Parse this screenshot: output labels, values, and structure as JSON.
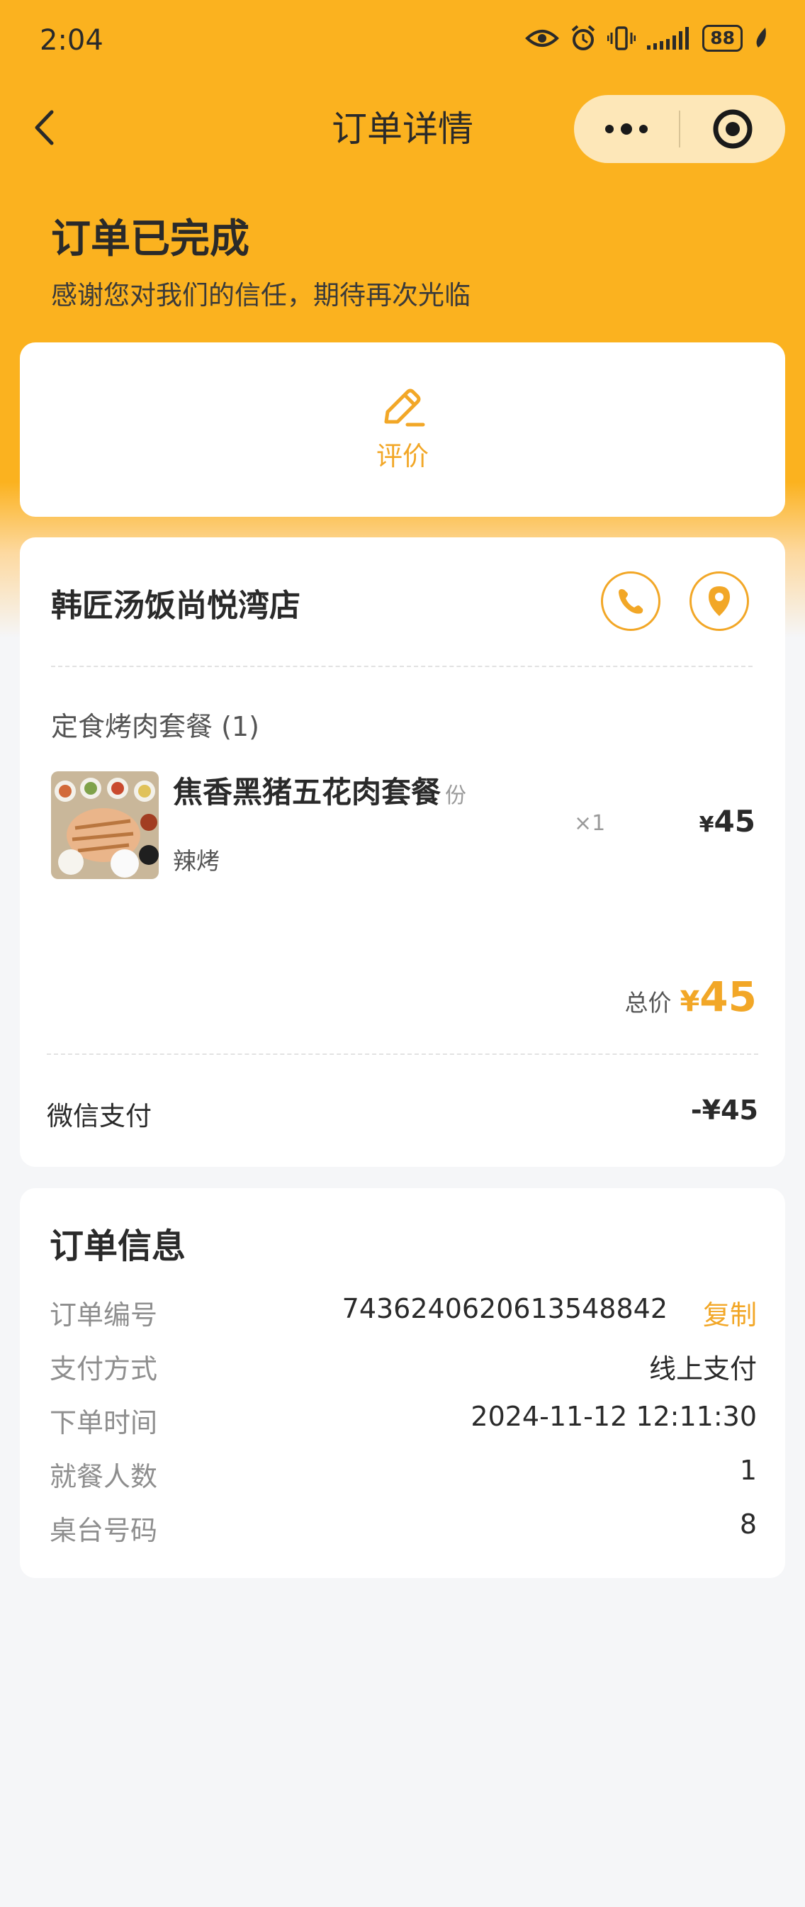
{
  "status_bar": {
    "time": "2:04",
    "battery": "88"
  },
  "nav": {
    "title": "订单详情"
  },
  "order_status": {
    "title": "订单已完成",
    "subtitle": "感谢您对我们的信任，期待再次光临"
  },
  "review": {
    "label": "评价"
  },
  "shop": {
    "name": "韩匠汤饭尚悦湾店",
    "category": "定食烤肉套餐 (1)",
    "item": {
      "name": "焦香黑猪五花肉套餐",
      "unit": "份",
      "spec": "辣烤",
      "quantity": "×1",
      "currency": "¥",
      "price": "45"
    },
    "total_label": "总价",
    "total_currency": "¥",
    "total_value": "45",
    "payment_method": "微信支付",
    "payment_amount": "-¥45"
  },
  "order_info": {
    "title": "订单信息",
    "rows": [
      {
        "label": "订单编号",
        "value": "7436240620613548842"
      },
      {
        "label": "支付方式",
        "value": "线上支付"
      },
      {
        "label": "下单时间",
        "value": "2024-11-12 12:11:30"
      },
      {
        "label": "就餐人数",
        "value": "1"
      },
      {
        "label": "桌台号码",
        "value": "8"
      }
    ],
    "copy_label": "复制"
  },
  "colors": {
    "brand": "#fbb21f",
    "accent": "#f2a727",
    "background": "#f5f6f8"
  }
}
